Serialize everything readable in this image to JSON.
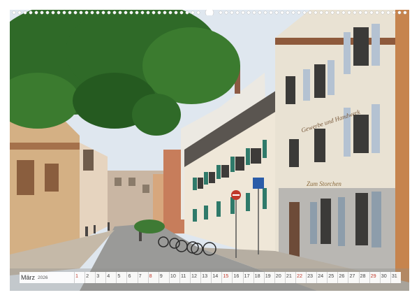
{
  "calendar": {
    "month": "März",
    "year": "2026",
    "days": [
      "1",
      "2",
      "3",
      "4",
      "5",
      "6",
      "7",
      "8",
      "9",
      "10",
      "11",
      "12",
      "13",
      "14",
      "15",
      "16",
      "17",
      "18",
      "19",
      "20",
      "21",
      "22",
      "23",
      "24",
      "25",
      "26",
      "27",
      "28",
      "29",
      "30",
      "31"
    ],
    "sundays": [
      1,
      8,
      15,
      22,
      29
    ]
  },
  "building_signs": {
    "facade_script_upper": "Gewerbe und Handwerk",
    "facade_script_lower": "Zum Storchen"
  }
}
